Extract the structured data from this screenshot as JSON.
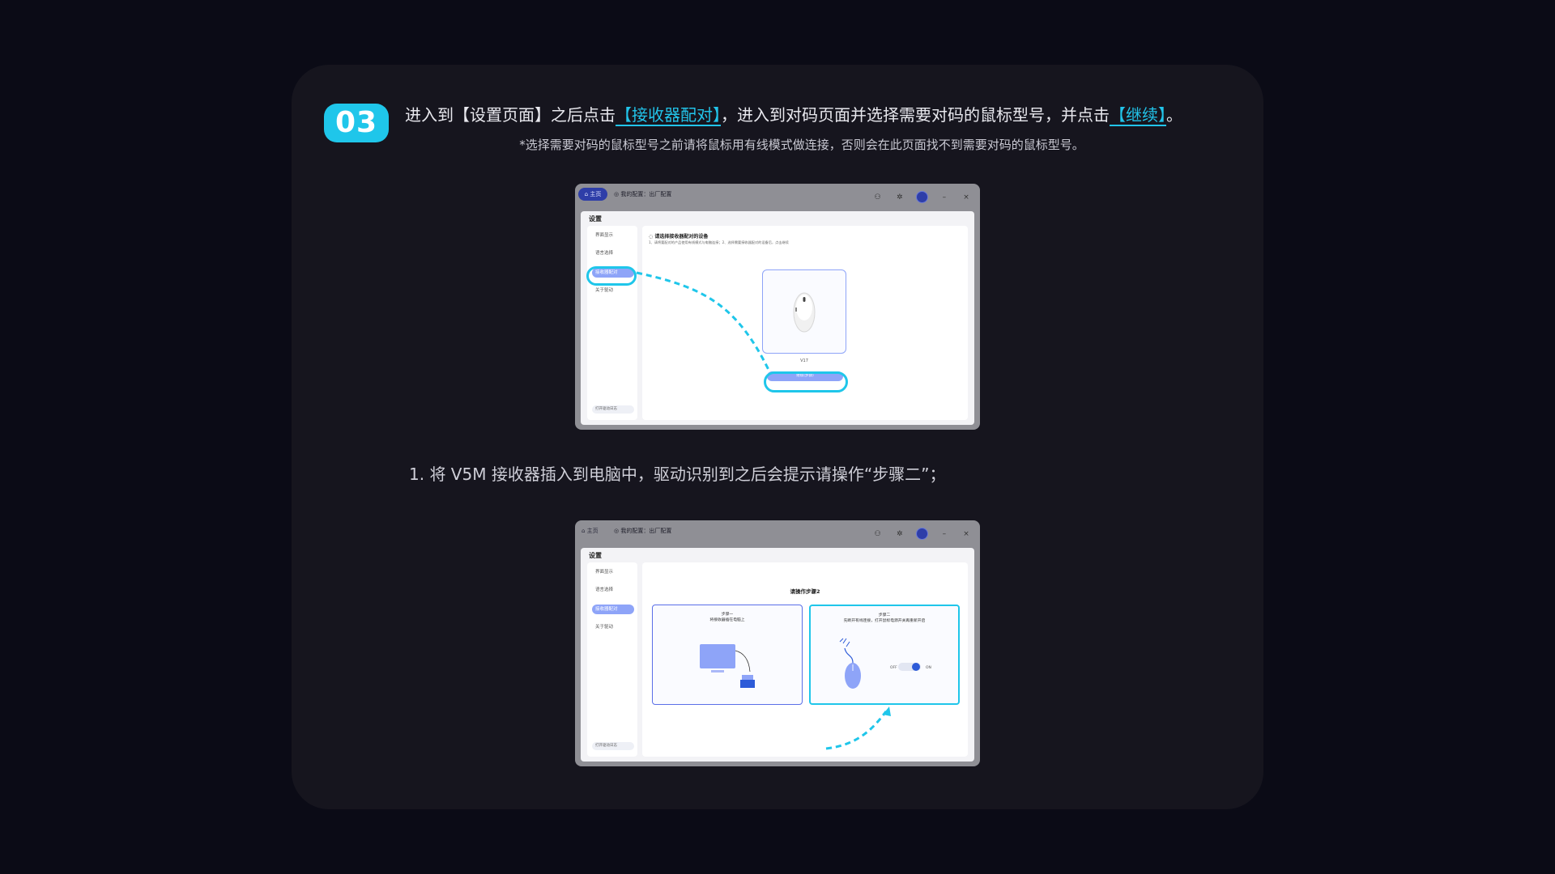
{
  "step": {
    "number": "03",
    "intro_prefix": "进入到【设置页面】之后点击",
    "intro_link1": "【接收器配对】",
    "intro_middle": "，进入到对码页面并选择需要对码的鼠标型号，并点击",
    "intro_link2": "【继续】",
    "intro_suffix": "。",
    "note": "*选择需要对码的鼠标型号之前请将鼠标用有线模式做连接，否则会在此页面找不到需要对码的鼠标型号。",
    "caption": "1. 将 V5M 接收器插入到电脑中，驱动识别到之后会提示请操作“步骤二”；"
  },
  "screenshot1": {
    "home_label": "主页",
    "config_label": "我的配置：出厂配置",
    "panel_title": "设置",
    "sidebar": [
      "界面显示",
      "语言选择",
      "接收器配对",
      "关于驱动"
    ],
    "sidebar_bottom": "打开驱动日志",
    "hint_title": "请选择接收器配对的设备",
    "hint_sub": "1、请将要配对的产品使用有线模式与电脑连接；2、选择需要接收器配对的设备后，点击继续",
    "device_name": "V17",
    "continue_label": "继续(步骤)"
  },
  "screenshot2": {
    "home_label": "主页",
    "config_label": "我的配置：出厂配置",
    "panel_title": "设置",
    "sidebar": [
      "界面显示",
      "语言选择",
      "接收器配对",
      "关于驱动"
    ],
    "sidebar_bottom": "打开驱动日志",
    "step_title": "请操作步骤2",
    "step1_label": "步骤一",
    "step1_desc": "将接收器插在电脑上",
    "step2_label": "步骤二",
    "step2_desc": "先断开有线连接，打开鼠标电源开关再重新开启",
    "off_label": "OFF",
    "on_label": "ON"
  },
  "colors": {
    "accent": "#1fc6ea",
    "primary": "#5a6fe8",
    "card_bg": "#16151e",
    "page_bg": "#0b0b16"
  }
}
